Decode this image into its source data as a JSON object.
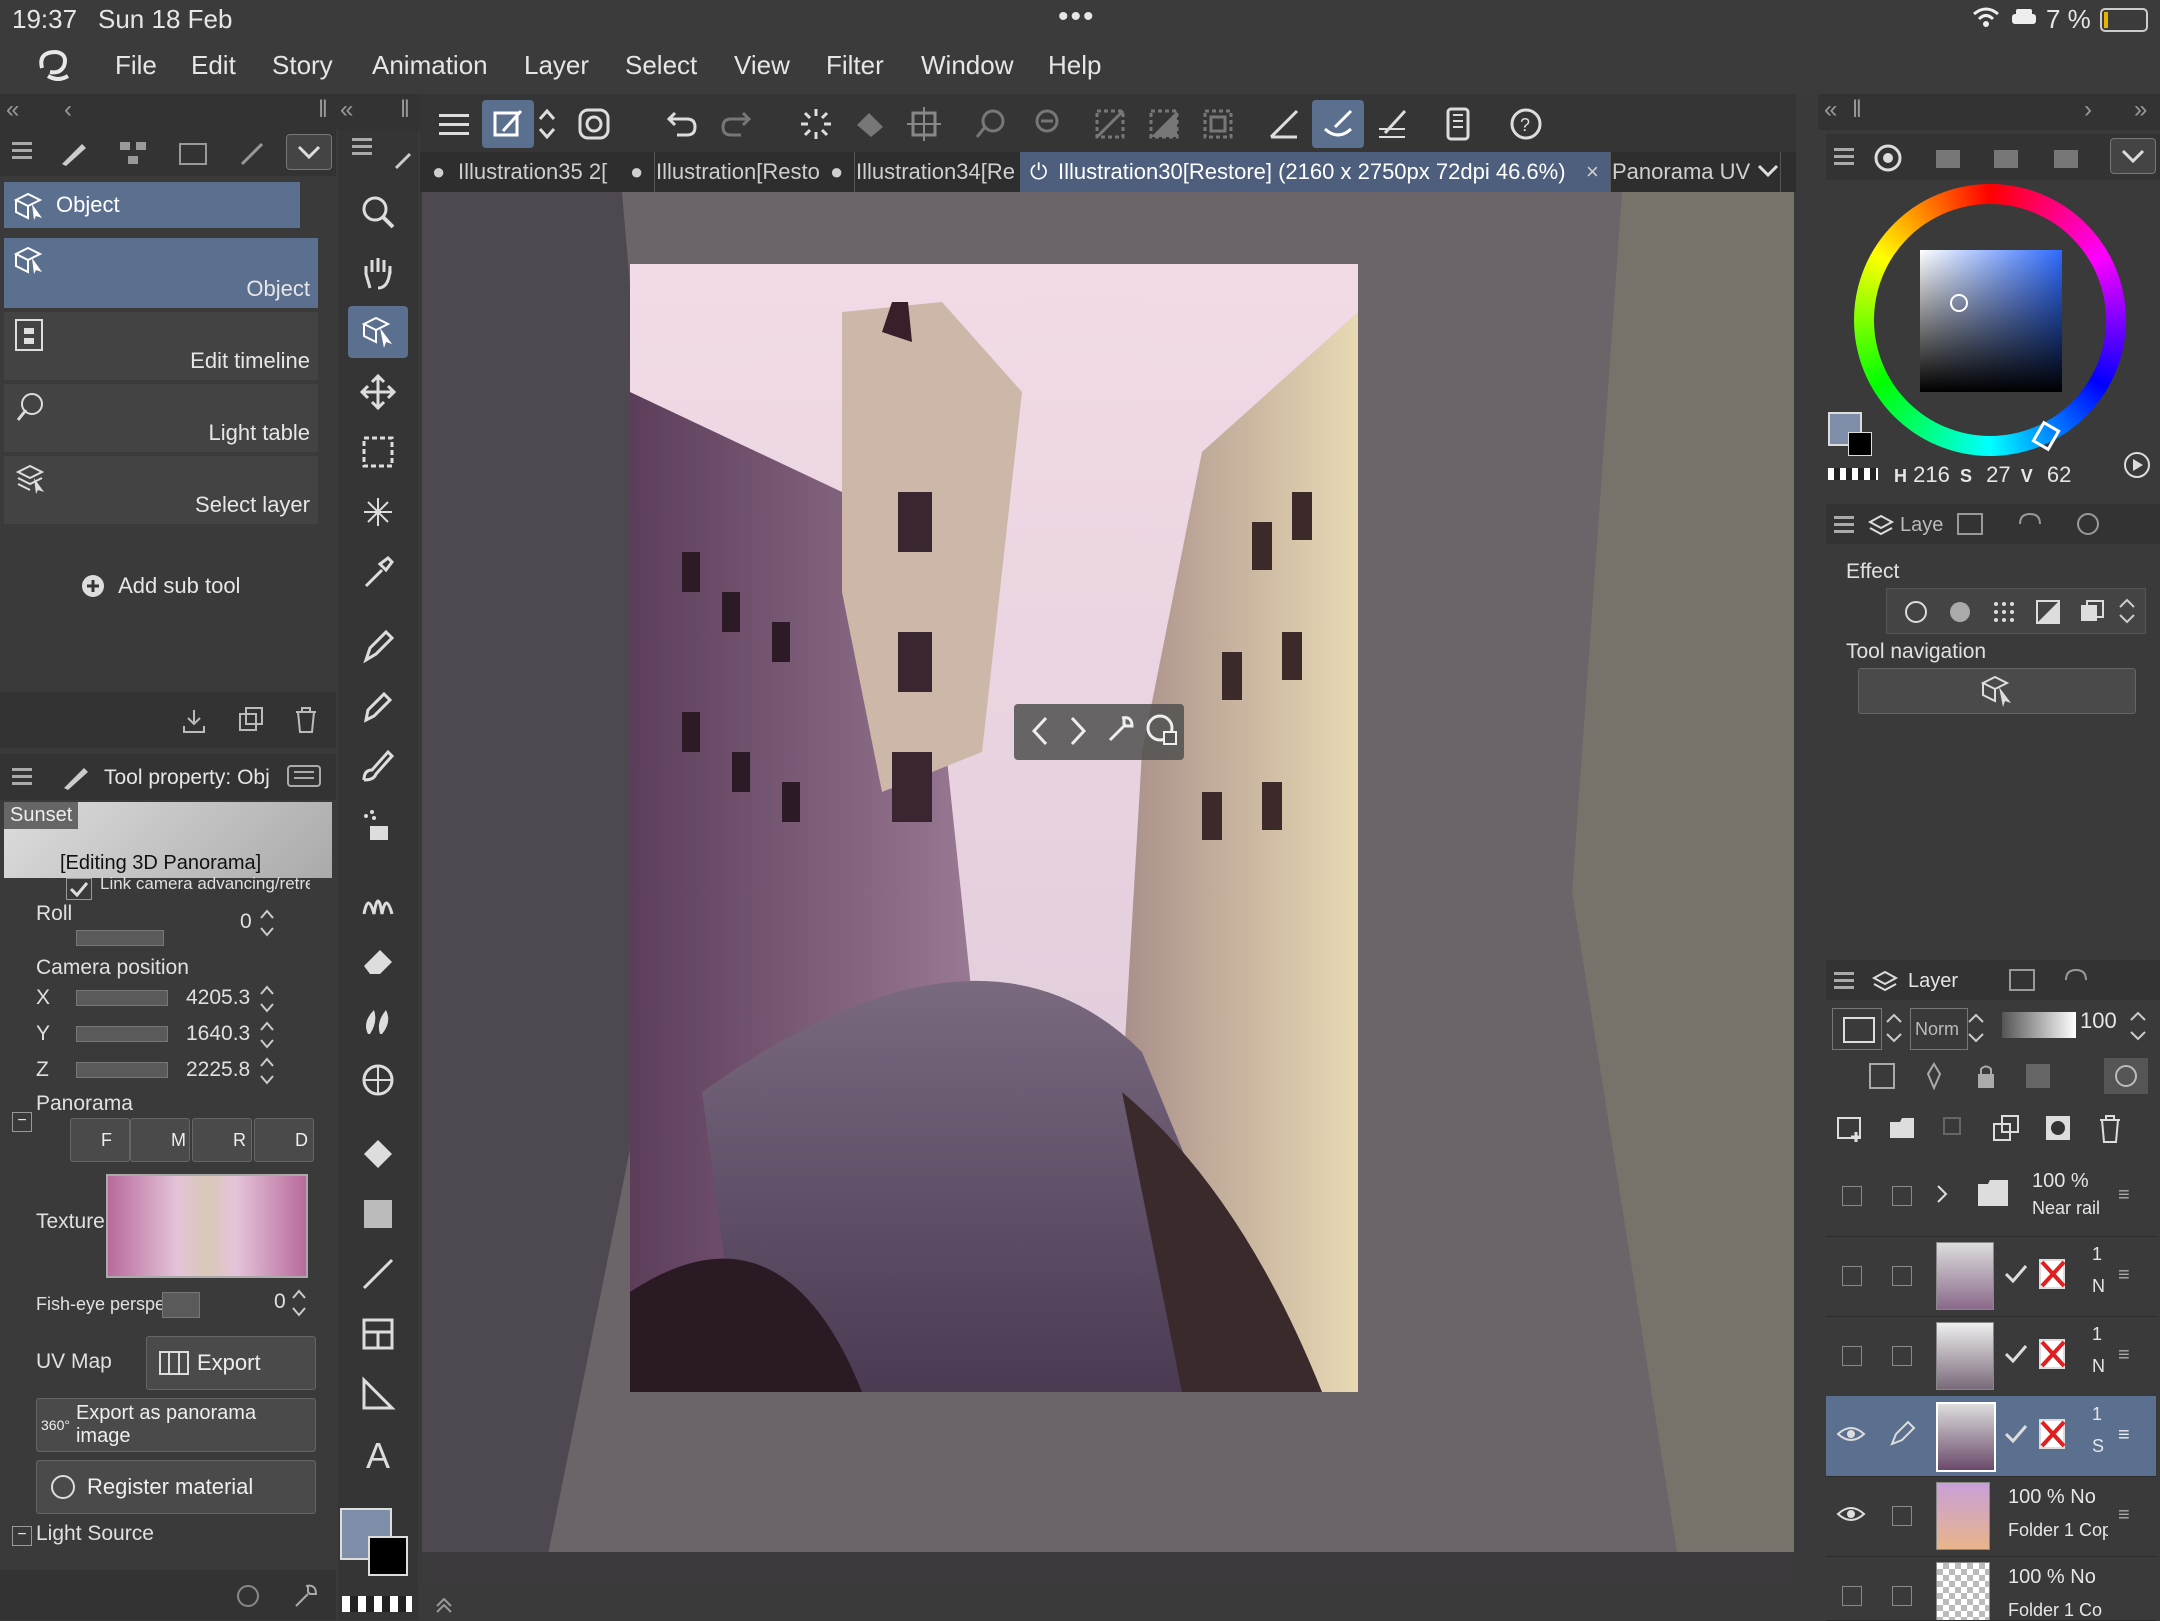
{
  "status": {
    "time": "19:37",
    "date": "Sun 18 Feb",
    "battery": "7 %"
  },
  "menu": [
    "File",
    "Edit",
    "Story",
    "Animation",
    "Layer",
    "Select",
    "View",
    "Filter",
    "Window",
    "Help"
  ],
  "tabs": [
    {
      "label": "Illustration35 2[",
      "prefix": "●"
    },
    {
      "label": "Illustration[Resto",
      "prefix": "●"
    },
    {
      "label": "Illustration34[Re",
      "prefix": "●"
    },
    {
      "label": "Illustration30[Restore] (2160 x 2750px 72dpi 46.6%)",
      "prefix": "⏻"
    },
    {
      "label": "Panorama UV",
      "prefix": "×"
    }
  ],
  "subtool": {
    "group_title": "Object",
    "items": [
      "Object",
      "Edit timeline",
      "Light table",
      "Select layer"
    ],
    "add_label": "Add sub tool"
  },
  "toolprop": {
    "title": "Tool property: Obj",
    "preset": "Sunset",
    "editing": "[Editing 3D Panorama]",
    "link_label": "Link camera advancing/retrea",
    "roll_label": "Roll",
    "roll_value": "0",
    "campos_label": "Camera position",
    "x_label": "X",
    "x_value": "4205.3",
    "y_label": "Y",
    "y_value": "1640.3",
    "z_label": "Z",
    "z_value": "2225.8",
    "panorama_label": "Panorama",
    "pano_btns": [
      "F",
      "M",
      "R",
      "D"
    ],
    "texture_label": "Texture",
    "fisheye_label": "Fish-eye perspe",
    "fisheye_value": "0",
    "uvmap_label": "UV Map",
    "export_label": "Export",
    "export_pano_label": "Export as panorama image",
    "register_label": "Register material",
    "light_label": "Light Source"
  },
  "color": {
    "h_label": "H",
    "h": "216",
    "s_label": "S",
    "s": "27",
    "v_label": "V",
    "v": "62",
    "main": "#7f8ea8"
  },
  "subview": {
    "tab_label": "Laye",
    "effect_label": "Effect",
    "toolnav_label": "Tool navigation"
  },
  "layers": {
    "tab_label": "Layer",
    "blend": "Norm",
    "opacity": "100",
    "rows": [
      {
        "line1": "100 %",
        "line2": "Near rail"
      },
      {
        "line1": "1",
        "line2": "N"
      },
      {
        "line1": "1",
        "line2": "N"
      },
      {
        "line1": "1",
        "line2": "S"
      },
      {
        "line1": "100 %  No",
        "line2": "Folder 1 Cop"
      },
      {
        "line1": "100 %  No",
        "line2": "Folder 1 Co"
      }
    ]
  }
}
